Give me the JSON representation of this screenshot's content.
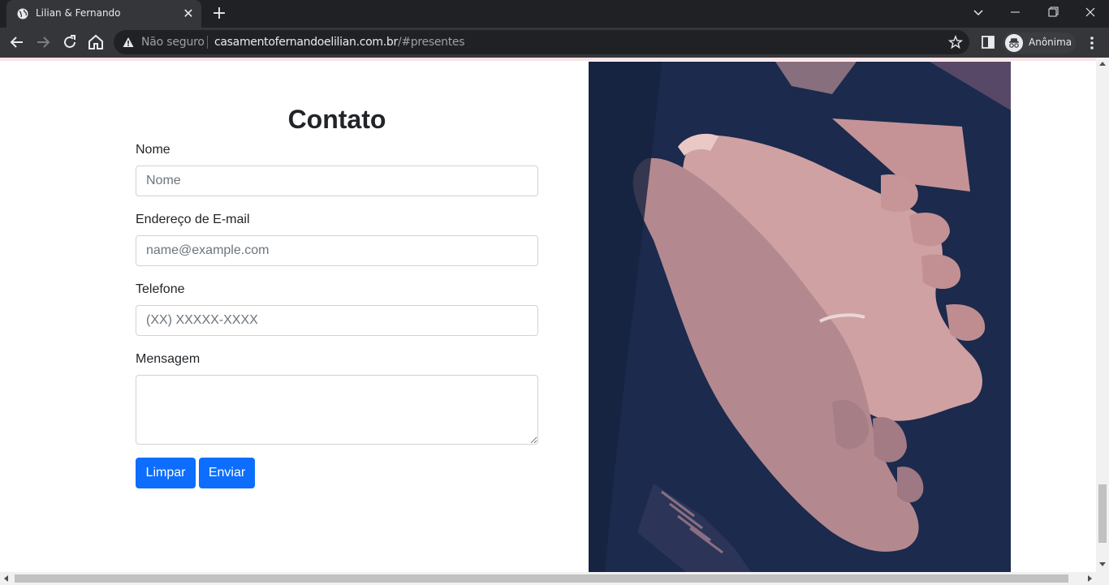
{
  "browser": {
    "tab_title": "Lilian & Fernando",
    "tab_close": "✕",
    "new_tab": "+",
    "security_label": "Não seguro",
    "url_host": "casamentofernandoelilian.com.br",
    "url_path": "/#presentes",
    "profile_label": "Anônima"
  },
  "form": {
    "title": "Contato",
    "name_label": "Nome",
    "name_placeholder": "Nome",
    "email_label": "Endereço de E-mail",
    "email_placeholder": "name@example.com",
    "phone_label": "Telefone",
    "phone_placeholder": "(XX) XXXXX-XXXX",
    "message_label": "Mensagem",
    "clear_button": "Limpar",
    "send_button": "Enviar"
  },
  "colors": {
    "primary": "#0d6efd",
    "photo_dark": "#1b2a4d",
    "photo_pink": "#c9989c",
    "accent_line": "#fbe3e6"
  }
}
